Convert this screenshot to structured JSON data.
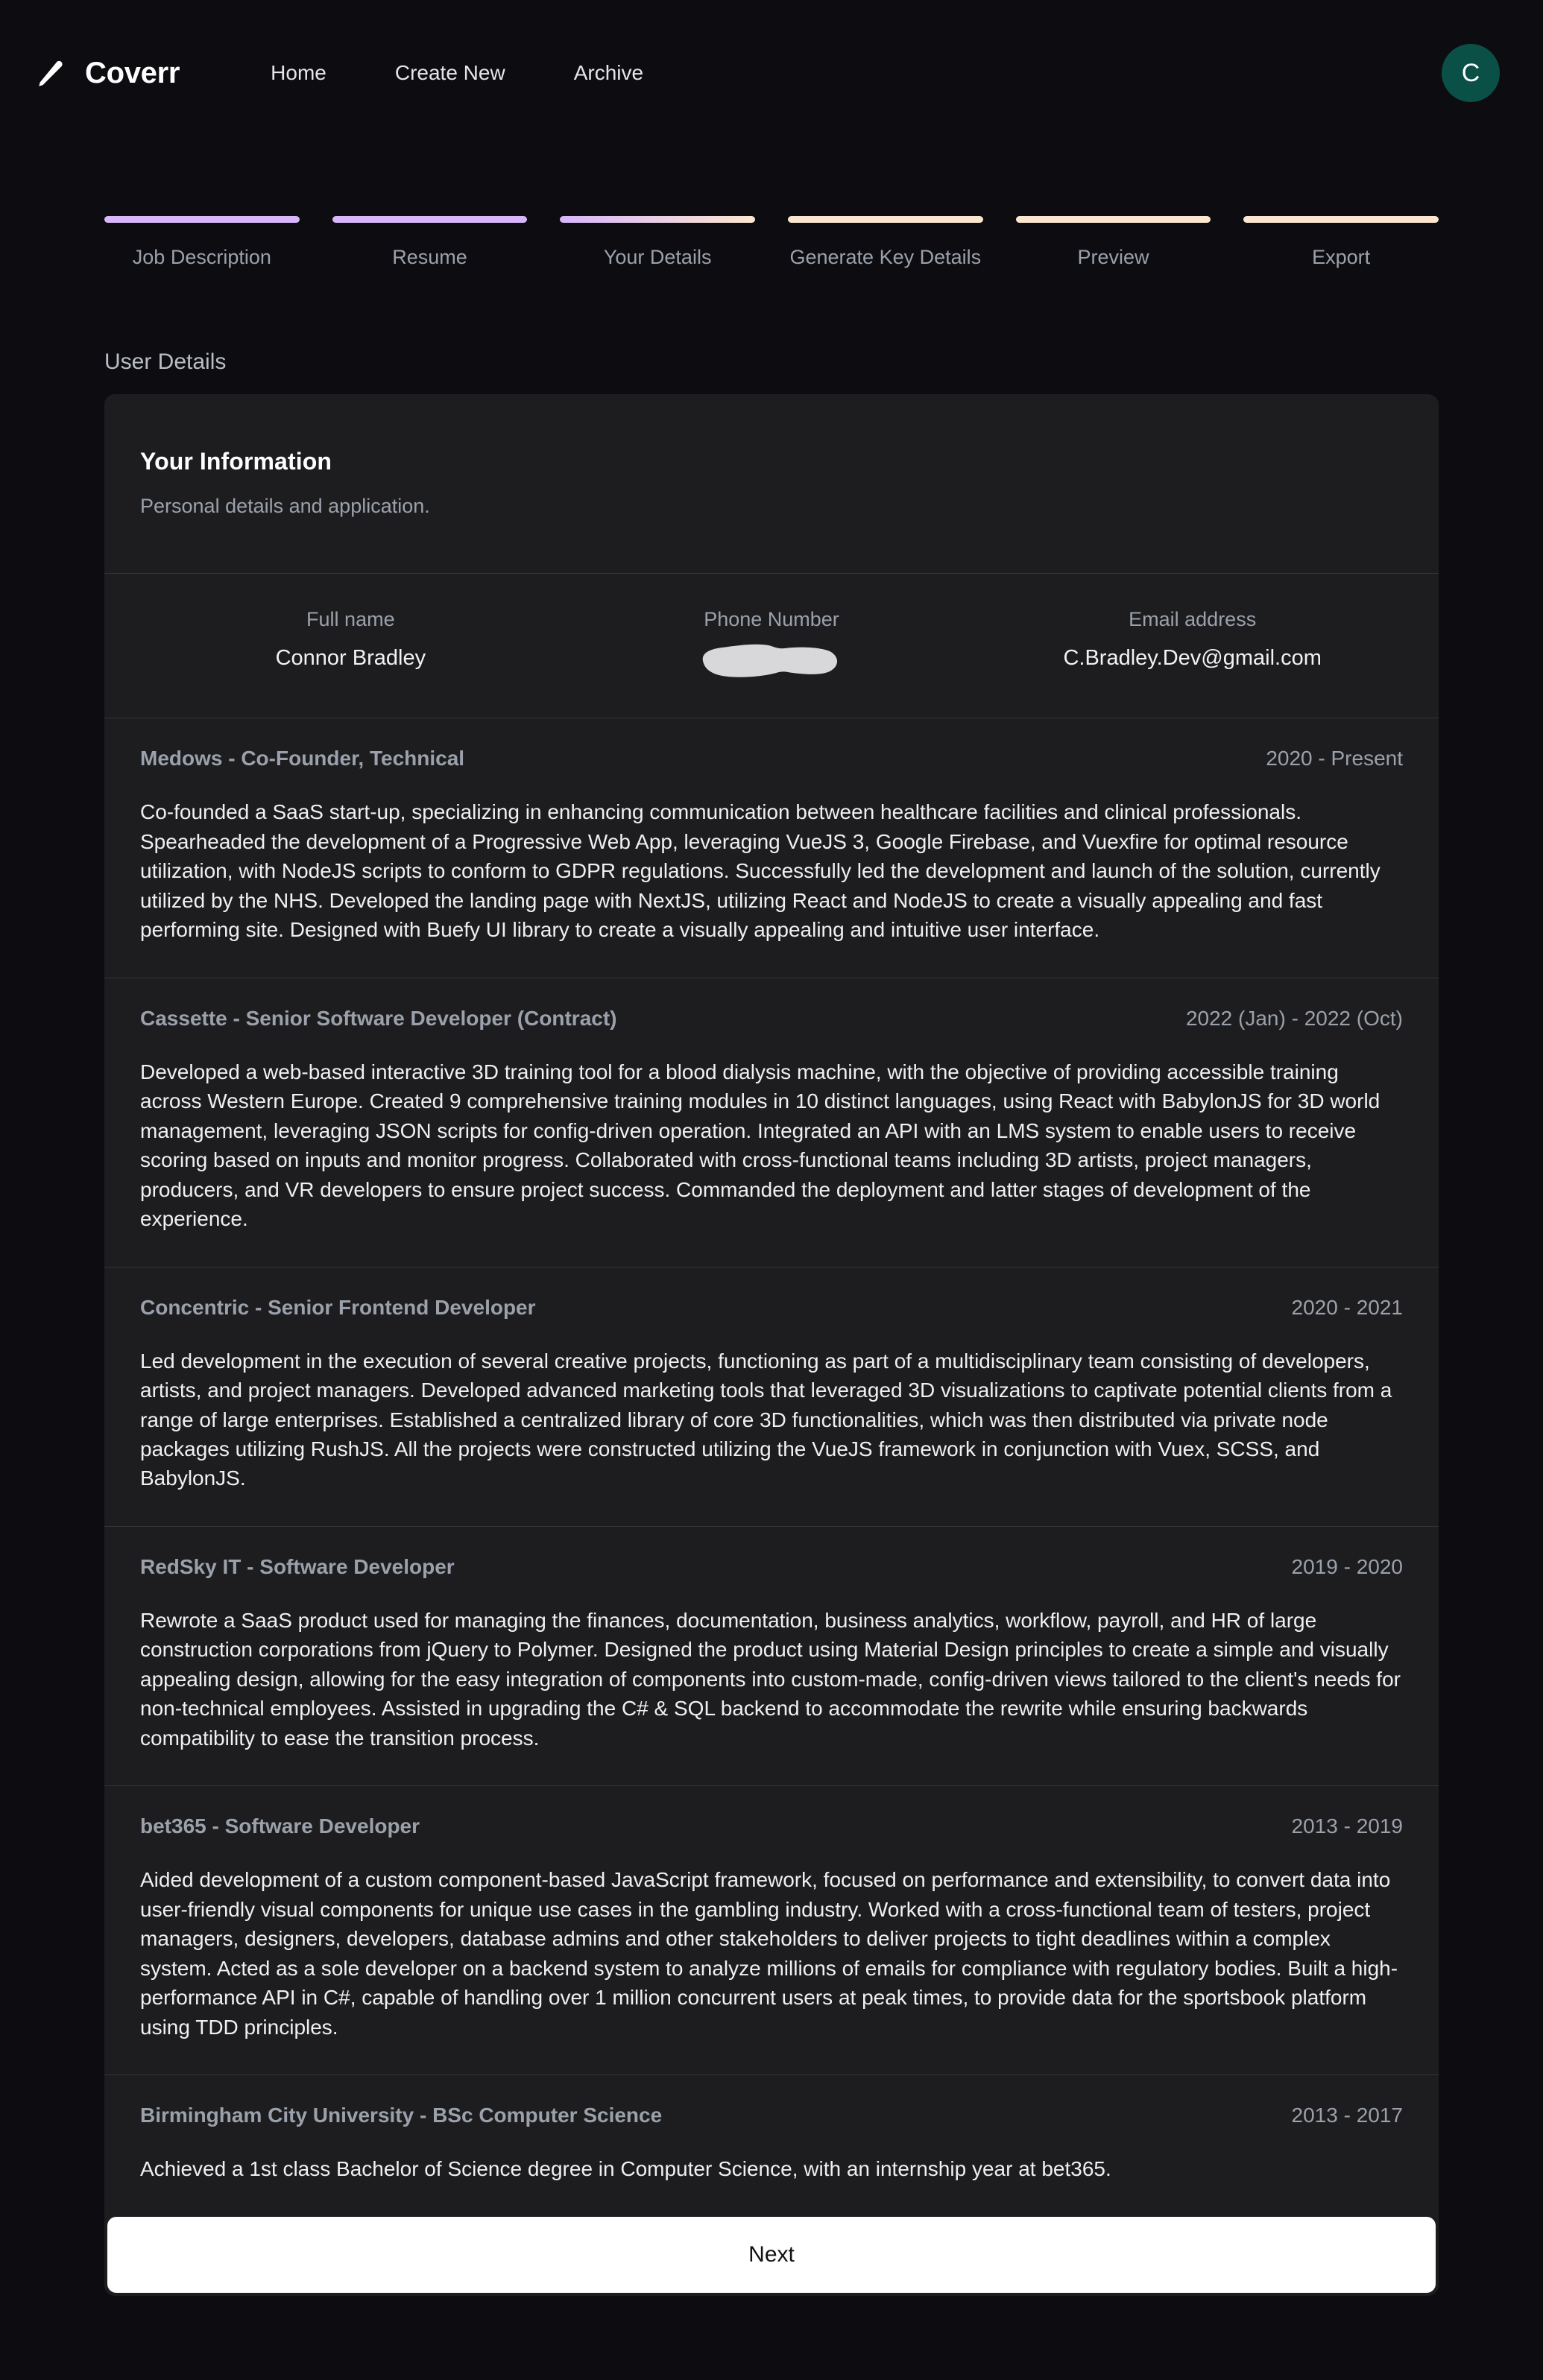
{
  "header": {
    "logo_icon": "pencil-icon",
    "brand": "Coverr",
    "nav": [
      {
        "label": "Home"
      },
      {
        "label": "Create New"
      },
      {
        "label": "Archive"
      }
    ],
    "avatar_initial": "C",
    "avatar_color": "#0b5046"
  },
  "stepper": {
    "steps": [
      {
        "label": "Job Description",
        "color": "#d7b6fa"
      },
      {
        "label": "Resume",
        "color": "#d7b6fa"
      },
      {
        "label": "Your Details",
        "color": "gradient"
      },
      {
        "label": "Generate Key Details",
        "color": "#fbe7d0"
      },
      {
        "label": "Preview",
        "color": "#fbe7d0"
      },
      {
        "label": "Export",
        "color": "#fbe7d0"
      }
    ],
    "gradient_from": "#d7b6fa",
    "gradient_to": "#fbe7d0"
  },
  "section": {
    "title": "User Details"
  },
  "card": {
    "heading": "Your Information",
    "subheading": "Personal details and application.",
    "contact": [
      {
        "label": "Full name",
        "value": "Connor Bradley",
        "redacted": false
      },
      {
        "label": "Phone Number",
        "value": "",
        "redacted": true
      },
      {
        "label": "Email address",
        "value": "C.Bradley.Dev@gmail.com",
        "redacted": false
      }
    ],
    "entries": [
      {
        "title": "Medows - Co-Founder, Technical",
        "dates": "2020 - Present",
        "body": "Co-founded a SaaS start-up, specializing in enhancing communication between healthcare facilities and clinical professionals. Spearheaded the development of a Progressive Web App, leveraging VueJS 3, Google Firebase, and Vuexfire for optimal resource utilization, with NodeJS scripts to conform to GDPR regulations. Successfully led the development and launch of the solution, currently utilized by the NHS. Developed the landing page with NextJS, utilizing React and NodeJS to create a visually appealing and fast performing site. Designed with Buefy UI library to create a visually appealing and intuitive user interface."
      },
      {
        "title": "Cassette - Senior Software Developer (Contract)",
        "dates": "2022 (Jan) - 2022 (Oct)",
        "body": "Developed a web-based interactive 3D training tool for a blood dialysis machine, with the objective of providing accessible training across Western Europe. Created 9 comprehensive training modules in 10 distinct languages, using React with BabylonJS for 3D world management, leveraging JSON scripts for config-driven operation. Integrated an API with an LMS system to enable users to receive scoring based on inputs and monitor progress. Collaborated with cross-functional teams including 3D artists, project managers, producers, and VR developers to ensure project success. Commanded the deployment and latter stages of development of the experience."
      },
      {
        "title": "Concentric - Senior Frontend Developer",
        "dates": "2020 - 2021",
        "body": "Led development in the execution of several creative projects, functioning as part of a multidisciplinary team consisting of developers, artists, and project managers. Developed advanced marketing tools that leveraged 3D visualizations to captivate potential clients from a range of large enterprises. Established a centralized library of core 3D functionalities, which was then distributed via private node packages utilizing RushJS. All the projects were constructed utilizing the VueJS framework in conjunction with Vuex, SCSS, and BabylonJS."
      },
      {
        "title": "RedSky IT - Software Developer",
        "dates": "2019 - 2020",
        "body": "Rewrote a SaaS product used for managing the finances, documentation, business analytics, workflow, payroll, and HR of large construction corporations from jQuery to Polymer. Designed the product using Material Design principles to create a simple and visually appealing design, allowing for the easy integration of components into custom-made, config-driven views tailored to the client's needs for non-technical employees. Assisted in upgrading the C# & SQL backend to accommodate the rewrite while ensuring backwards compatibility to ease the transition process."
      },
      {
        "title": "bet365 - Software Developer",
        "dates": "2013 - 2019",
        "body": "Aided development of a custom component-based JavaScript framework, focused on performance and extensibility, to convert data into user-friendly visual components for unique use cases in the gambling industry. Worked with a cross-functional team of testers, project managers, designers, developers, database admins and other stakeholders to deliver projects to tight deadlines within a complex system. Acted as a sole developer on a backend system to analyze millions of emails for compliance with regulatory bodies. Built a high-performance API in C#, capable of handling over 1 million concurrent users at peak times, to provide data for the sportsbook platform using TDD principles."
      },
      {
        "title": "Birmingham City University - BSc Computer Science",
        "dates": "2013 - 2017",
        "body": "Achieved a 1st class Bachelor of Science degree in Computer Science, with an internship year at bet365."
      }
    ],
    "next_label": "Next"
  }
}
